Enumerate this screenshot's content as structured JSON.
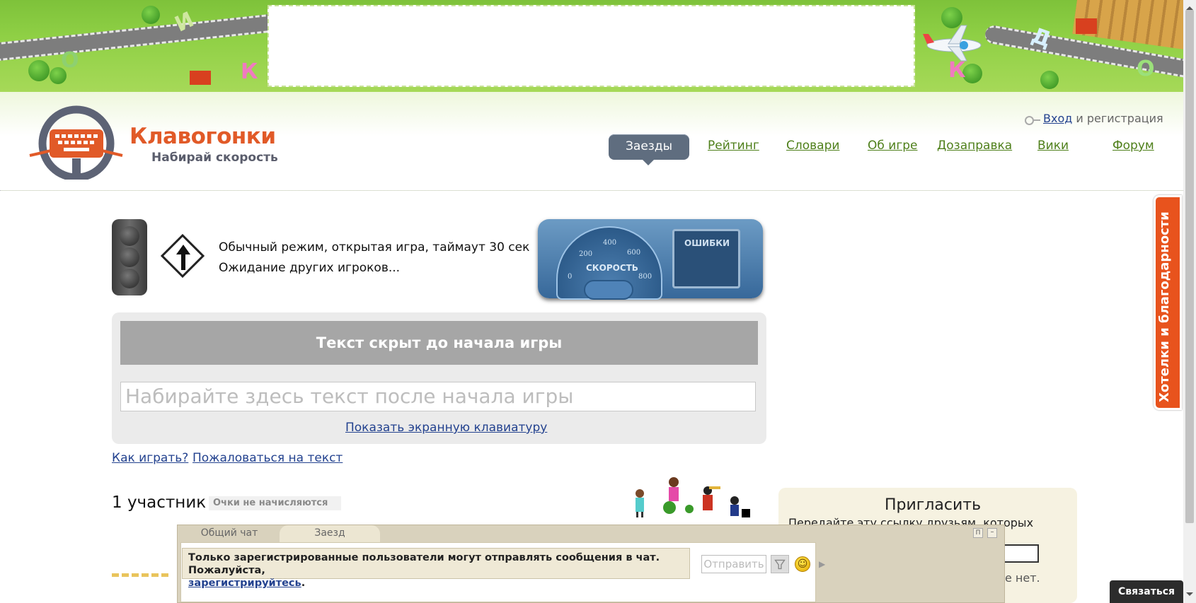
{
  "banner": {
    "letters": [
      "И",
      "О",
      "К",
      "К",
      "Д",
      "О"
    ]
  },
  "logo": {
    "title": "Клавогонки",
    "subtitle": "Набирай скорость"
  },
  "auth": {
    "login_label": "Вход",
    "register_text": "и регистрация"
  },
  "nav": {
    "items": [
      {
        "label": "Заезды",
        "active": true
      },
      {
        "label": "Рейтинг"
      },
      {
        "label": "Словари"
      },
      {
        "label": "Об игре"
      },
      {
        "label": "Дозаправка"
      },
      {
        "label": "Вики"
      },
      {
        "label": "Форум"
      }
    ]
  },
  "game": {
    "mode_text": "Обычный режим, открытая игра, таймаут 30 сек",
    "waiting_text": "Ожидание других игроков...",
    "speed_label": "СКОРОСТЬ",
    "speed_ticks": [
      "0",
      "200",
      "400",
      "600",
      "800"
    ],
    "errors_label": "ОШИБКИ",
    "hidden_text": "Текст скрыт до начала игры",
    "input_placeholder": "Набирайте здесь текст после начала игры",
    "keyboard_link": "Показать экранную клавиатуру",
    "how_to_play": "Как играть?",
    "complain": "Пожаловаться на текст",
    "participants": "1 участник",
    "points_note": "Очки не начисляются"
  },
  "invite": {
    "title": "Пригласить",
    "text": "Передайте эту ссылку друзьям, которых хотите",
    "tail": "е нет."
  },
  "chat": {
    "tabs": [
      "Общий чат",
      "Заезд"
    ],
    "notice": "Только зарегистрированные пользователи могут отправлять сообщения в чат. Пожалуйста,",
    "register_link": "зарегистрируйтесь",
    "send_button": "Отправить",
    "pin": "П",
    "minimize": "–"
  },
  "sidetab": {
    "label": "Хотелки и благодарности"
  },
  "contact": {
    "label": "Связаться"
  },
  "colors": {
    "accent": "#e15a28",
    "nav_link": "#4e7f1a",
    "nav_active": "#5f6d7f",
    "link": "#23428f"
  }
}
